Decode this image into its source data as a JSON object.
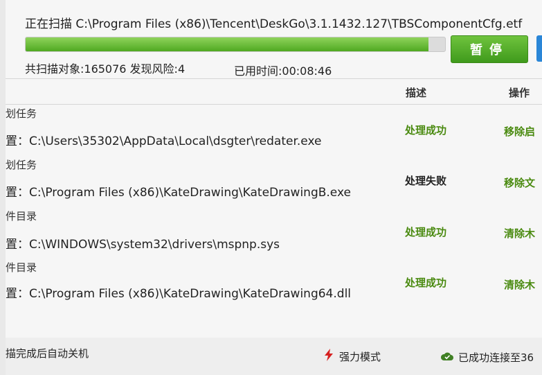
{
  "scan": {
    "label": "正在扫描 C:\\Program Files (x86)\\Tencent\\DeskGo\\3.1.1432.127\\TBSComponentCfg.etf",
    "progress": 0.96,
    "pause_label": "暂停",
    "stats_objects": "共扫描对象:165076 发现风险:4",
    "stats_time": "已用时间:00:08:46"
  },
  "table": {
    "col_description": "描述",
    "col_action": "操作",
    "rows": [
      {
        "type": "划任务",
        "path": "置：C:\\Users\\35302\\AppData\\Local\\dsgter\\redater.exe",
        "status": "处理成功",
        "action": "移除启"
      },
      {
        "type": "划任务",
        "path": "置：C:\\Program Files (x86)\\KateDrawing\\KateDrawingB.exe",
        "status": "处理失败",
        "action": "移除文"
      },
      {
        "type": "件目录",
        "path": "置：C:\\WINDOWS\\system32\\drivers\\mspnp.sys",
        "status": "处理成功",
        "action": "清除木"
      },
      {
        "type": "件目录",
        "path": "置：C:\\Program Files (x86)\\KateDrawing\\KateDrawing64.dll",
        "status": "处理成功",
        "action": "清除木"
      }
    ]
  },
  "footer": {
    "auto_shutdown": "描完成后自动关机",
    "mode": "强力模式",
    "connection": "已成功连接至36"
  },
  "colors": {
    "success": "#4a8a10",
    "failure": "#222222",
    "accent_green": "#4fa921"
  },
  "icons": {
    "mode_icon": "lightning-icon",
    "connection_icon": "cloud-check-icon"
  }
}
